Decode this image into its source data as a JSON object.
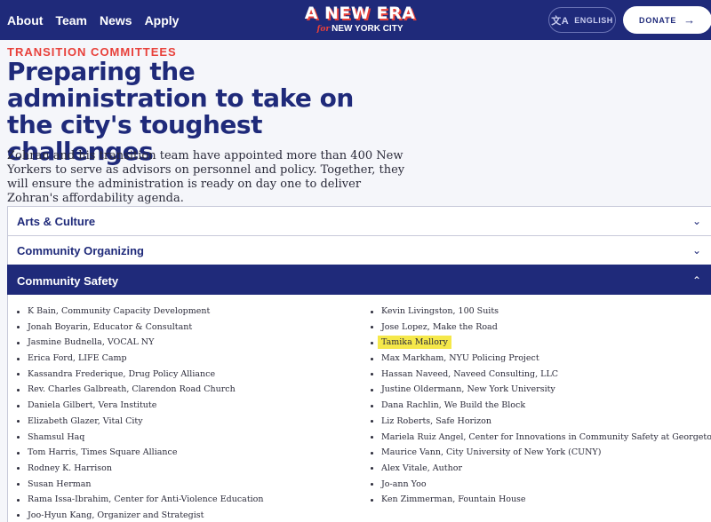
{
  "nav": {
    "items": [
      "About",
      "Team",
      "News",
      "Apply"
    ]
  },
  "logo": {
    "main": "A NEW ERA",
    "for": "for",
    "sub": "NEW YORK CITY"
  },
  "header_actions": {
    "language_label": "ENGLISH",
    "donate_label": "DONATE"
  },
  "hero": {
    "eyebrow": "TRANSITION COMMITTEES",
    "title": "Preparing the administration to take on the city's toughest challenges",
    "intro": "Zohran and his transition team have appointed more than 400 New Yorkers to serve as advisors on personnel and policy. Together, they will ensure the administration is ready on day one to deliver Zohran's affordability agenda."
  },
  "accordion": [
    {
      "label": "Arts & Culture",
      "open": false
    },
    {
      "label": "Community Organizing",
      "open": false
    },
    {
      "label": "Community Safety",
      "open": true
    }
  ],
  "community_safety": {
    "left": [
      "K Bain, Community Capacity Development",
      "Jonah Boyarin, Educator & Consultant",
      "Jasmine Budnella, VOCAL NY",
      "Erica Ford, LIFE Camp",
      "Kassandra Frederique, Drug Policy Alliance",
      "Rev. Charles Galbreath, Clarendon Road Church",
      "Daniela Gilbert, Vera Institute",
      "Elizabeth Glazer, Vital City",
      "Shamsul Haq",
      "Tom Harris, Times Square Alliance",
      "Rodney K. Harrison",
      "Susan Herman",
      "Rama Issa-Ibrahim, Center for Anti-Violence Education",
      "Joo-Hyun Kang, Organizer and Strategist"
    ],
    "right": [
      "Kevin Livingston, 100 Suits",
      "Jose Lopez, Make the Road",
      "Tamika Mallory",
      "Max Markham, NYU Policing Project",
      "Hassan Naveed, Naveed Consulting, LLC",
      "Justine Oldermann, New York University",
      "Dana Rachlin, We Build the Block",
      "Liz Roberts, Safe Horizon",
      "Mariela Ruiz Angel, Center for Innovations in Community Safety at Georgetown Law",
      "Maurice Vann, City University of New York (CUNY)",
      "Alex Vitale, Author",
      "Jo-ann Yoo",
      "Ken Zimmerman, Fountain House"
    ],
    "highlighted": "Tamika Mallory",
    "highlight_color": "#f5e84a"
  },
  "colors": {
    "brand_navy": "#1f2a7a",
    "accent_red": "#e8403a",
    "background": "#f5f6fa"
  }
}
